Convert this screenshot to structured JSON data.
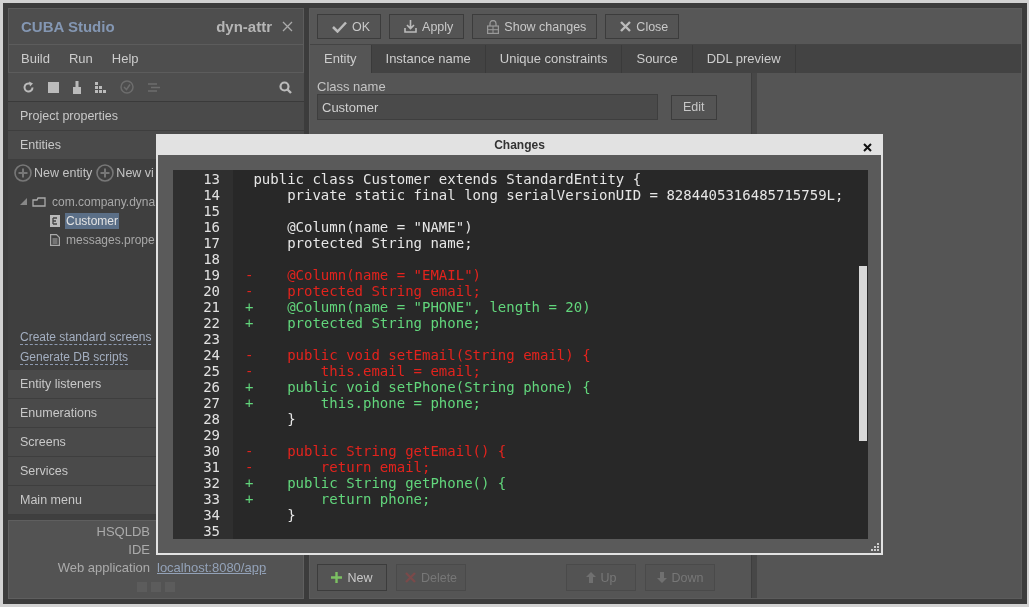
{
  "sidebar": {
    "app_title": "CUBA Studio",
    "project": "dyn-attr",
    "menu": [
      "Build",
      "Run",
      "Help"
    ],
    "sections_top": [
      "Project properties",
      "Entities"
    ],
    "entities": {
      "actions": [
        "New entity",
        "New vi"
      ],
      "tree": [
        {
          "label": "com.company.dyna",
          "kind": "package",
          "expanded": true,
          "selected": false,
          "children": [
            {
              "label": "Customer",
              "kind": "entity",
              "selected": true
            },
            {
              "label": "messages.prope",
              "kind": "file",
              "selected": false
            }
          ]
        }
      ],
      "links": [
        "Create standard screens",
        "Generate DB scripts"
      ]
    },
    "sections_bottom": [
      "Entity listeners",
      "Enumerations",
      "Screens",
      "Services",
      "Main menu"
    ],
    "status": [
      {
        "label": "HSQLDB"
      },
      {
        "label": "IDE"
      },
      {
        "label": "Web application",
        "link": "localhost:8080/app"
      }
    ]
  },
  "editor": {
    "toolbar": [
      {
        "label": "OK",
        "kind": "ok"
      },
      {
        "label": "Apply",
        "kind": "apply"
      },
      {
        "label": "Show changes",
        "kind": "changes"
      },
      {
        "label": "Close",
        "kind": "close"
      }
    ],
    "tabs": [
      {
        "label": "Entity",
        "selected": true
      },
      {
        "label": "Instance name",
        "selected": false
      },
      {
        "label": "Unique constraints",
        "selected": false
      },
      {
        "label": "Source",
        "selected": false
      },
      {
        "label": "DDL preview",
        "selected": false
      }
    ],
    "class_name": {
      "label": "Class name",
      "value": "Customer",
      "button": "Edit"
    },
    "bottom_buttons": [
      {
        "label": "New",
        "kind": "add",
        "disabled": false
      },
      {
        "label": "Delete",
        "kind": "remove",
        "disabled": true
      },
      {
        "label": "Up",
        "kind": "up",
        "disabled": true
      },
      {
        "label": "Down",
        "kind": "down",
        "disabled": true
      }
    ]
  },
  "dialog": {
    "title": "Changes",
    "lines": [
      {
        "number": "13",
        "kind": "context",
        "text": "public class Customer extends StandardEntity {"
      },
      {
        "number": "14",
        "kind": "context",
        "text": "    private static final long serialVersionUID = 8284405316485715759L;"
      },
      {
        "number": "15",
        "kind": "context"
      },
      {
        "number": "16",
        "kind": "context",
        "text": "    @Column(name = \"NAME\")"
      },
      {
        "number": "17",
        "kind": "context",
        "text": "    protected String name;"
      },
      {
        "number": "18",
        "kind": "context"
      },
      {
        "number": "19",
        "kind": "removed",
        "marker": "-",
        "text": "    @Column(name = \"EMAIL\")"
      },
      {
        "number": "20",
        "kind": "removed",
        "marker": "-",
        "text": "    protected String email;"
      },
      {
        "number": "21",
        "kind": "added",
        "marker": "+",
        "text": "    @Column(name = \"PHONE\", length = 20)"
      },
      {
        "number": "22",
        "kind": "added",
        "marker": "+",
        "text": "    protected String phone;"
      },
      {
        "number": "23",
        "kind": "context"
      },
      {
        "number": "24",
        "kind": "removed",
        "marker": "-",
        "text": "    public void setEmail(String email) {"
      },
      {
        "number": "25",
        "kind": "removed",
        "marker": "-",
        "text": "        this.email = email;"
      },
      {
        "number": "26",
        "kind": "added",
        "marker": "+",
        "text": "    public void setPhone(String phone) {"
      },
      {
        "number": "27",
        "kind": "added",
        "marker": "+",
        "text": "        this.phone = phone;"
      },
      {
        "number": "28",
        "kind": "context",
        "text": "    }"
      },
      {
        "number": "29",
        "kind": "context"
      },
      {
        "number": "30",
        "kind": "removed",
        "marker": "-",
        "text": "    public String getEmail() {"
      },
      {
        "number": "31",
        "kind": "removed",
        "marker": "-",
        "text": "        return email;"
      },
      {
        "number": "32",
        "kind": "added",
        "marker": "+",
        "text": "    public String getPhone() {"
      },
      {
        "number": "33",
        "kind": "added",
        "marker": "+",
        "text": "        return phone;"
      },
      {
        "number": "34",
        "kind": "context",
        "text": "    }"
      },
      {
        "number": "35",
        "kind": "context"
      }
    ]
  }
}
